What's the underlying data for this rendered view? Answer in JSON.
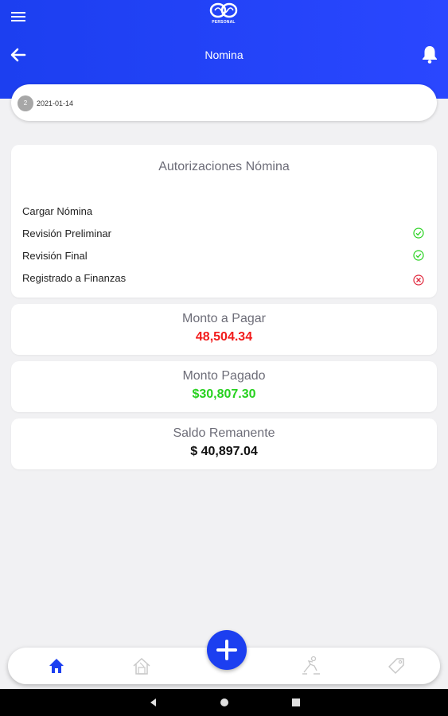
{
  "header": {
    "title": "Nomina",
    "logo_text": "PERSONAL"
  },
  "date_bar": {
    "badge": "2",
    "date": "2021-01-14"
  },
  "authorizations": {
    "title": "Autorizaciones Nómina",
    "items": [
      {
        "label": "Cargar Nómina",
        "status": "none"
      },
      {
        "label": "Revisión Preliminar",
        "status": "approved"
      },
      {
        "label": "Revisión Final",
        "status": "approved"
      },
      {
        "label": "Registrado a Finanzas",
        "status": "rejected"
      }
    ]
  },
  "amounts": [
    {
      "label": "Monto a Pagar",
      "value": "48,504.34",
      "color": "#f21b1b"
    },
    {
      "label": "Monto Pagado",
      "value": "$30,807.30",
      "color": "#27d11f"
    },
    {
      "label": "Saldo Remanente",
      "value": "$ 40,897.04",
      "color": "#111111"
    }
  ],
  "bottom_nav": {
    "items": [
      "home-icon",
      "house-outline-icon",
      "add-icon",
      "workout-icon",
      "tag-icon"
    ],
    "active": "home-icon"
  },
  "colors": {
    "primary": "#1c3ff0",
    "approved": "#27d11f",
    "rejected": "#e0263b"
  }
}
